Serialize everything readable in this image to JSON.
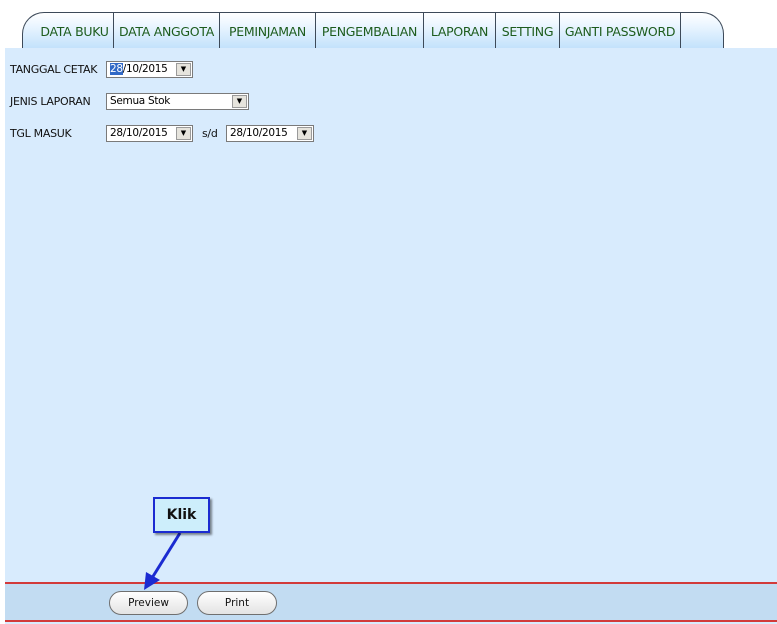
{
  "nav": {
    "tabs": [
      {
        "label": "DATA BUKU"
      },
      {
        "label": "DATA ANGGOTA"
      },
      {
        "label": "PEMINJAMAN"
      },
      {
        "label": "PENGEMBALIAN"
      },
      {
        "label": "LAPORAN"
      },
      {
        "label": "SETTING"
      },
      {
        "label": "GANTI PASSWORD"
      }
    ]
  },
  "form": {
    "tanggal_cetak": {
      "label": "TANGGAL CETAK",
      "value_selected": "28",
      "value_rest": "/10/2015"
    },
    "jenis_laporan": {
      "label": "JENIS LAPORAN",
      "value": "Semua Stok"
    },
    "tgl_masuk": {
      "label": "TGL MASUK",
      "from": "28/10/2015",
      "separator": "s/d",
      "to": "28/10/2015"
    }
  },
  "actions": {
    "preview": "Preview",
    "print": "Print"
  },
  "annotation": {
    "text": "Klik"
  }
}
